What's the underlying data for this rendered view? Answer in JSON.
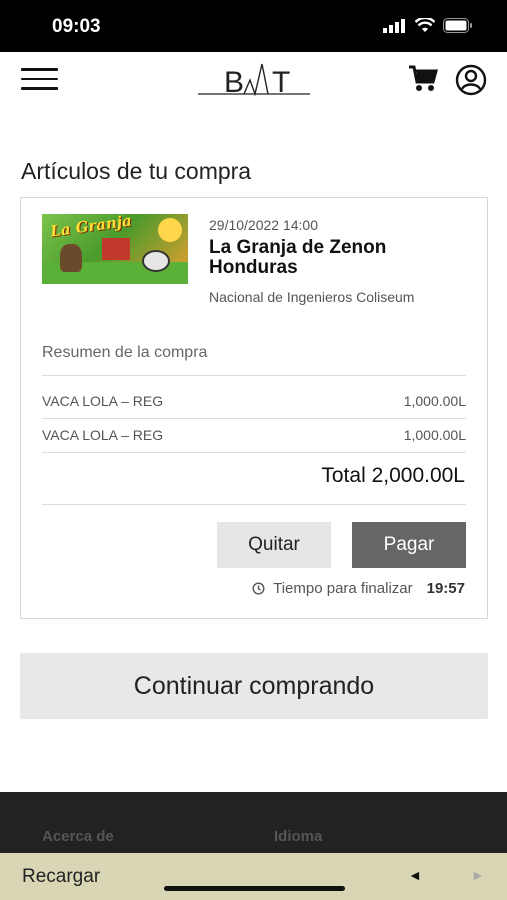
{
  "status_bar": {
    "time": "09:03"
  },
  "header": {
    "logo_text": "BAT"
  },
  "section_title": "Artículos de tu compra",
  "event": {
    "date": "29/10/2022 14:00",
    "name": "La Granja de Zenon Honduras",
    "venue": "Nacional de Ingenieros Coliseum",
    "image_text": "La Granja"
  },
  "summary": {
    "title": "Resumen de la compra",
    "items": [
      {
        "name": "VACA LOLA – REG",
        "price": "1,000.00L"
      },
      {
        "name": "VACA LOLA – REG",
        "price": "1,000.00L"
      }
    ],
    "total": "Total 2,000.00L"
  },
  "actions": {
    "remove_label": "Quitar",
    "pay_label": "Pagar"
  },
  "timer": {
    "label": "Tiempo para finalizar",
    "value": "19:57"
  },
  "continue_label": "Continuar comprando",
  "footer": {
    "about_label": "Acerca de",
    "language_label": "Idioma"
  },
  "browser_bar": {
    "reload_label": "Recargar",
    "back_icon": "◄",
    "forward_icon": "►"
  },
  "colors": {
    "pay_button": "#666666",
    "bottom_bar": "#d9d6b5",
    "footer": "#222222"
  }
}
